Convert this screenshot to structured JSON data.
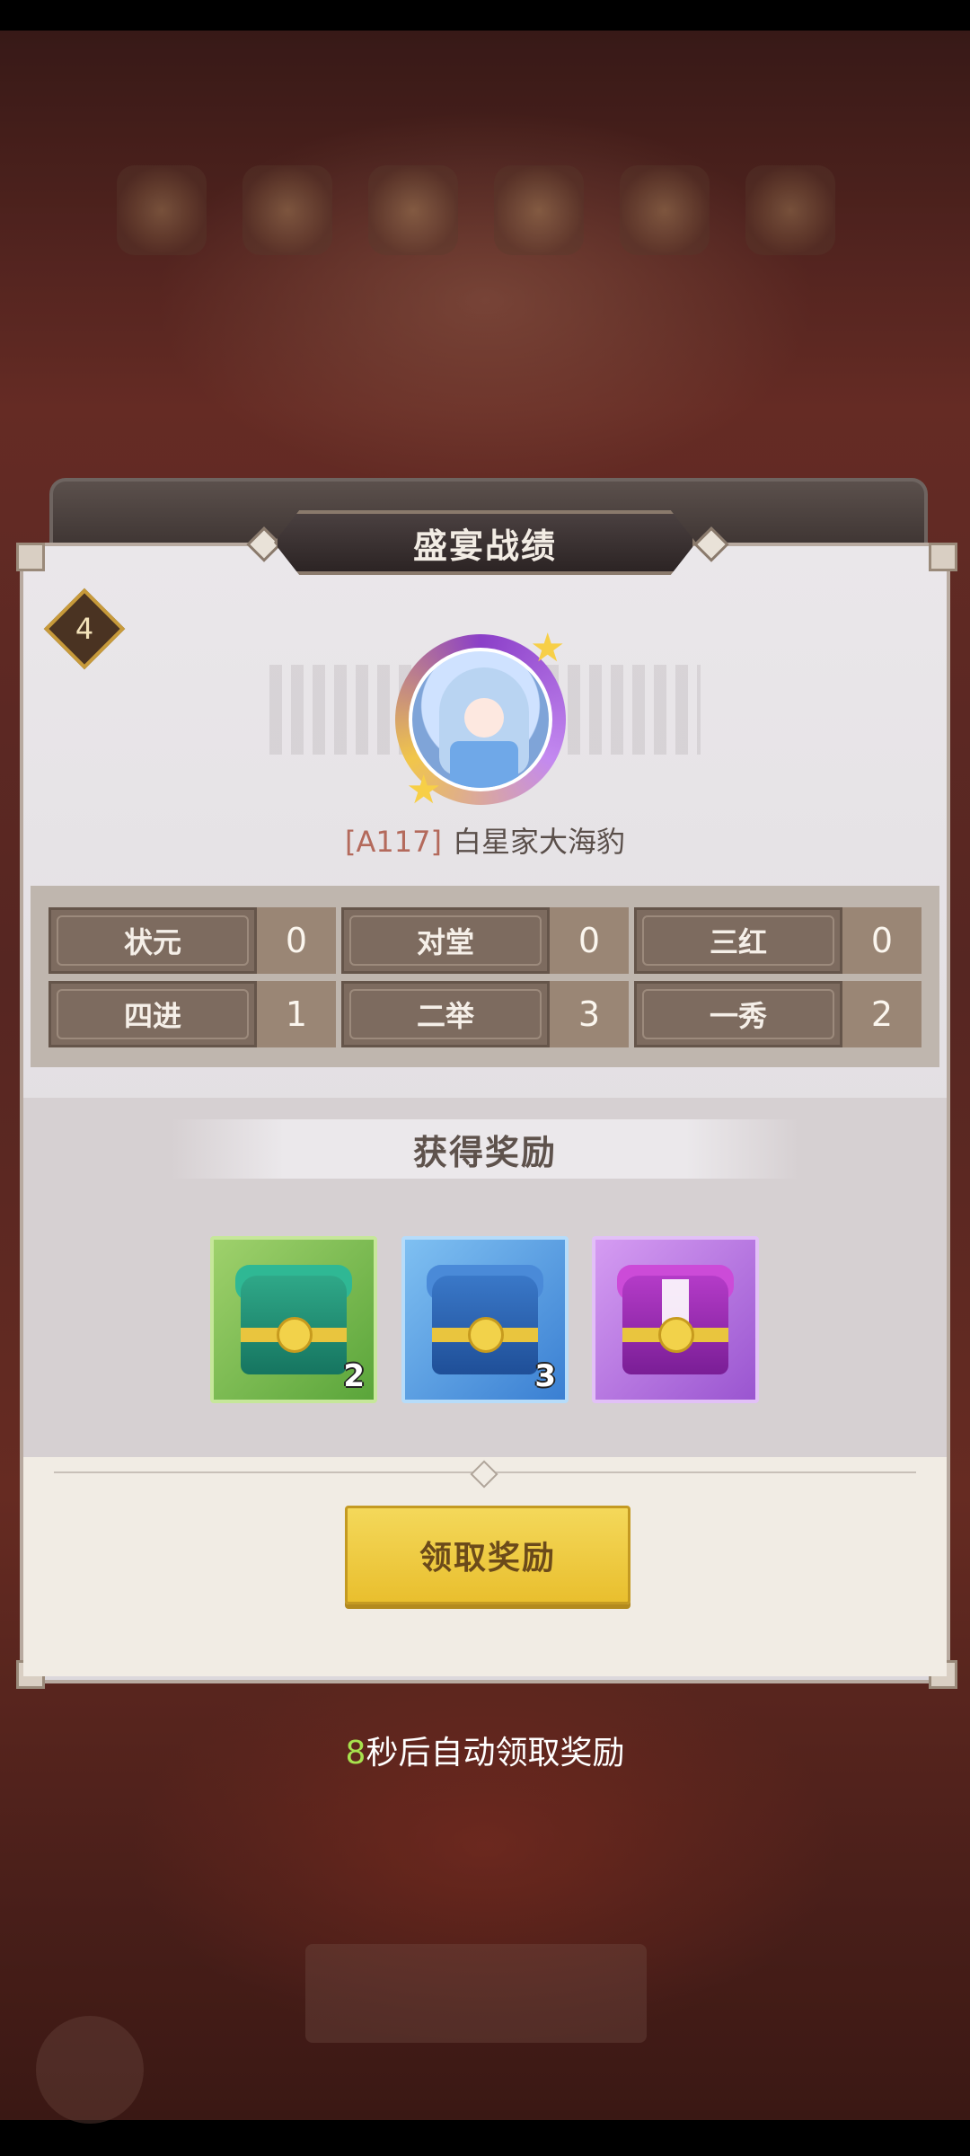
{
  "dialog": {
    "title": "盛宴战绩",
    "rank": "4",
    "player": {
      "code": "[A117]",
      "name": "白星家大海豹"
    }
  },
  "stats": [
    {
      "label": "状元",
      "value": "0"
    },
    {
      "label": "对堂",
      "value": "0"
    },
    {
      "label": "三红",
      "value": "0"
    },
    {
      "label": "四进",
      "value": "1"
    },
    {
      "label": "二举",
      "value": "3"
    },
    {
      "label": "一秀",
      "value": "2"
    }
  ],
  "rewards": {
    "title": "获得奖励",
    "items": [
      {
        "icon": "green-chest-icon",
        "count": "2"
      },
      {
        "icon": "blue-chest-icon",
        "count": "3"
      },
      {
        "icon": "purple-chest-icon",
        "count": ""
      }
    ]
  },
  "claim_button": "领取奖励",
  "auto_claim": {
    "seconds": "8",
    "text": "秒后自动领取奖励"
  },
  "colors": {
    "accent": "#e9bf2e",
    "timer": "#a7e24e"
  }
}
